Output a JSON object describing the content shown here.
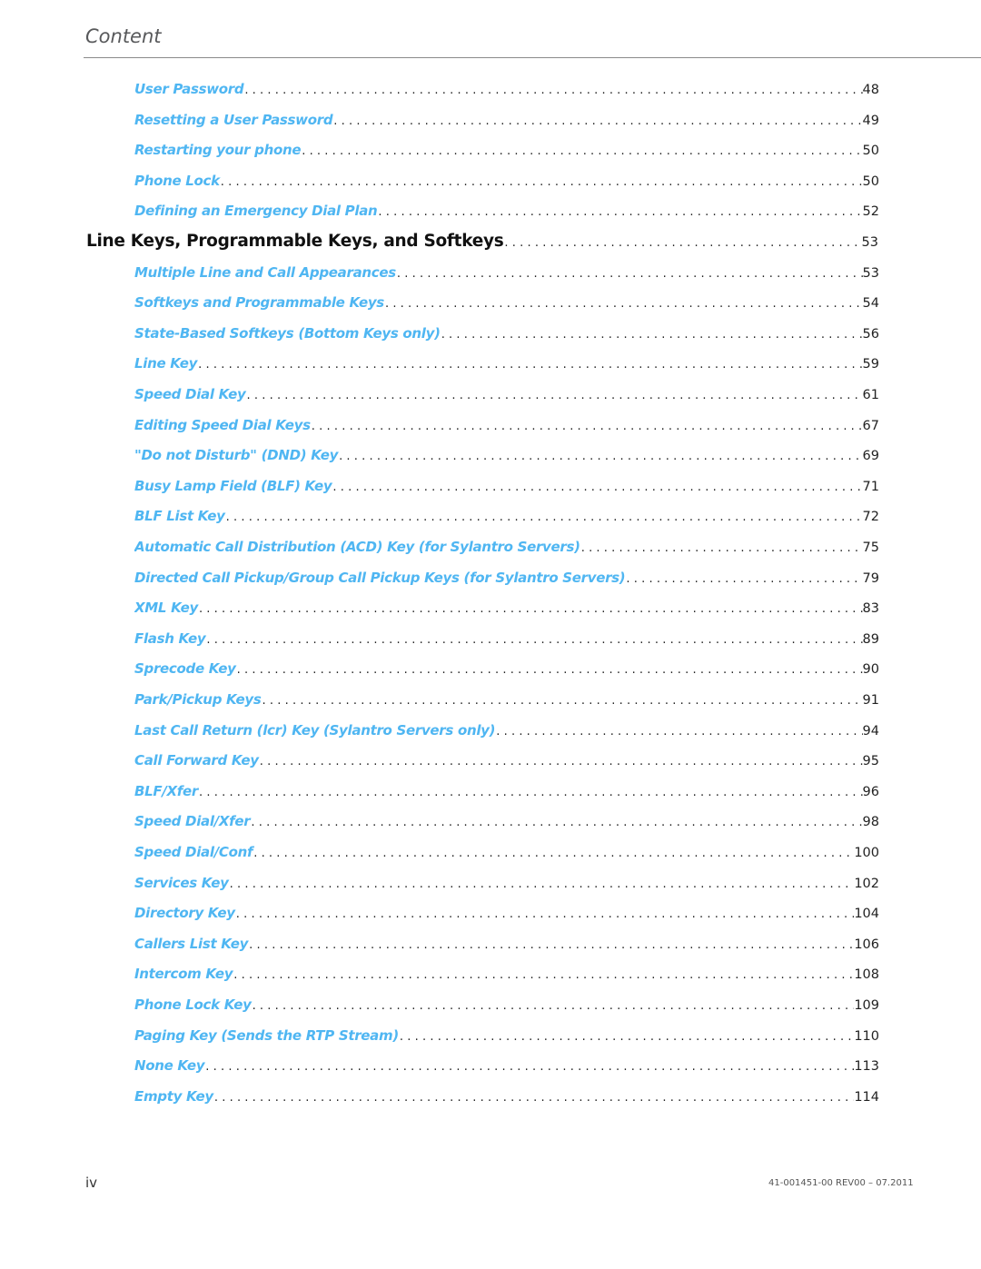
{
  "header": {
    "title": "Content"
  },
  "toc": [
    {
      "level": "sub",
      "title": "User Password",
      "page": "48"
    },
    {
      "level": "sub",
      "title": "Resetting a User Password",
      "page": "49"
    },
    {
      "level": "sub",
      "title": "Restarting your phone",
      "page": "50"
    },
    {
      "level": "sub",
      "title": "Phone Lock",
      "page": "50"
    },
    {
      "level": "sub",
      "title": "Defining an Emergency Dial Plan",
      "page": "52"
    },
    {
      "level": "chap",
      "title": "Line Keys, Programmable Keys, and Softkeys",
      "page": "53"
    },
    {
      "level": "sub",
      "title": "Multiple Line and Call Appearances",
      "page": "53"
    },
    {
      "level": "sub",
      "title": "Softkeys and Programmable Keys",
      "page": "54"
    },
    {
      "level": "sub",
      "title": "State-Based Softkeys (Bottom Keys only)",
      "page": "56"
    },
    {
      "level": "sub",
      "title": "Line Key",
      "page": "59"
    },
    {
      "level": "sub",
      "title": "Speed Dial Key",
      "page": "61"
    },
    {
      "level": "sub",
      "title": "Editing Speed Dial Keys",
      "page": "67"
    },
    {
      "level": "sub",
      "title": "\"Do not Disturb\" (DND) Key",
      "page": "69"
    },
    {
      "level": "sub",
      "title": "Busy Lamp Field (BLF) Key",
      "page": "71"
    },
    {
      "level": "sub",
      "title": "BLF List Key",
      "page": "72"
    },
    {
      "level": "sub",
      "title": "Automatic Call Distribution (ACD) Key (for Sylantro Servers)",
      "page": "75"
    },
    {
      "level": "sub",
      "title": "Directed Call Pickup/Group Call Pickup Keys (for Sylantro Servers)",
      "page": "79"
    },
    {
      "level": "sub",
      "title": "XML Key",
      "page": "83"
    },
    {
      "level": "sub",
      "title": "Flash Key",
      "page": "89"
    },
    {
      "level": "sub",
      "title": "Sprecode Key",
      "page": "90"
    },
    {
      "level": "sub",
      "title": "Park/Pickup Keys",
      "page": "91"
    },
    {
      "level": "sub",
      "title": "Last Call Return (lcr) Key (Sylantro Servers only)",
      "page": "94"
    },
    {
      "level": "sub",
      "title": "Call Forward Key",
      "page": "95"
    },
    {
      "level": "sub",
      "title": "BLF/Xfer",
      "page": "96"
    },
    {
      "level": "sub",
      "title": "Speed Dial/Xfer",
      "page": "98"
    },
    {
      "level": "sub",
      "title": "Speed Dial/Conf",
      "page": "100"
    },
    {
      "level": "sub",
      "title": "Services Key",
      "page": "102"
    },
    {
      "level": "sub",
      "title": "Directory Key",
      "page": "104"
    },
    {
      "level": "sub",
      "title": "Callers List Key",
      "page": "106"
    },
    {
      "level": "sub",
      "title": "Intercom Key",
      "page": "108"
    },
    {
      "level": "sub",
      "title": "Phone Lock Key",
      "page": "109"
    },
    {
      "level": "sub",
      "title": "Paging Key (Sends the RTP Stream)",
      "page": "110"
    },
    {
      "level": "sub",
      "title": "None Key",
      "page": "113"
    },
    {
      "level": "sub",
      "title": "Empty Key",
      "page": "114"
    }
  ],
  "footer": {
    "page_number": "iv",
    "doc_id": "41-001451-00 REV00 – 07.2011"
  },
  "colors": {
    "link": "#4fb6f2",
    "chapter": "#111111",
    "header": "#58595b"
  }
}
